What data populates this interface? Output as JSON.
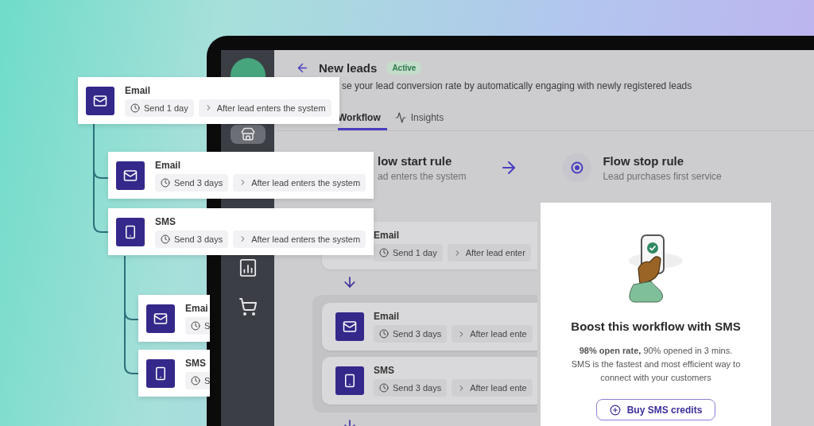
{
  "sidebar": {
    "items": [
      {
        "kind": "logo",
        "selected": false
      },
      {
        "kind": "store",
        "selected": true
      },
      {
        "kind": "chart",
        "selected": false
      },
      {
        "kind": "cart",
        "selected": false
      }
    ]
  },
  "header": {
    "title": "New leads",
    "status": "Active",
    "description": "se your lead conversion rate by automatically engaging with newly registered leads"
  },
  "tabs": [
    {
      "label": "Workflow",
      "selected": true
    },
    {
      "label": "Insights",
      "selected": false
    }
  ],
  "rules": {
    "start": {
      "title": "low start rule",
      "subtitle": "ad enters the system"
    },
    "stop": {
      "title": "Flow stop rule",
      "subtitle": "Lead purchases first service"
    }
  },
  "workflow": [
    {
      "steps": [
        {
          "title": "Email",
          "delay": "Send 1 day",
          "trigger": "After lead enter"
        }
      ]
    },
    {
      "steps": [
        {
          "kind": "email",
          "title": "Email",
          "delay": "Send 3 days",
          "trigger": "After lead ente"
        },
        {
          "kind": "sms",
          "title": "SMS",
          "delay": "Send 3 days",
          "trigger": "After lead ente"
        }
      ]
    }
  ],
  "flow_tree": {
    "kind": "email",
    "title": "Email",
    "delay": "Send 1 day",
    "trigger": "After lead enters the system",
    "children": [
      {
        "kind": "email",
        "title": "Email",
        "delay": "Send 3 days",
        "trigger": "After lead enters the system"
      },
      {
        "kind": "sms",
        "title": "SMS",
        "delay": "Send 3 days",
        "trigger": "After lead enters the system",
        "children": [
          {
            "kind": "email",
            "title": "Emai",
            "delay": "S"
          },
          {
            "kind": "sms",
            "title": "SMS",
            "delay": "S"
          }
        ]
      }
    ]
  },
  "promo": {
    "title": "Boost this workflow with SMS",
    "lines": [
      "**98% open rate,** 90% opened in 3 mins.",
      "SMS is the fastest and most efficient way to connect with your customers"
    ],
    "button": "Buy SMS credits"
  }
}
